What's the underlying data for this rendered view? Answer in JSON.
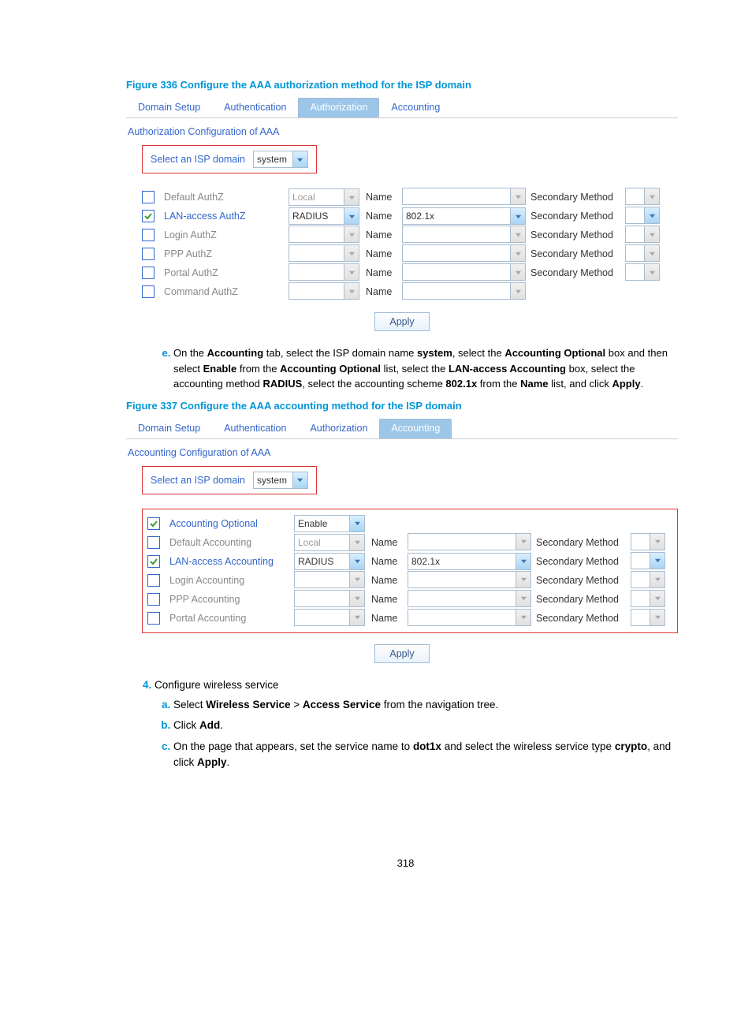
{
  "page_number": "318",
  "fig1": {
    "caption": "Figure 336 Configure the AAA authorization method for the ISP domain",
    "tabs": [
      "Domain Setup",
      "Authentication",
      "Authorization",
      "Accounting"
    ],
    "active_tab": 2,
    "section_title": "Authorization Configuration of AAA",
    "isp_label": "Select an ISP domain",
    "isp_value": "system",
    "name_lbl": "Name",
    "sec_lbl": "Secondary Method",
    "rows": [
      {
        "chk": false,
        "dis": true,
        "label": "Default AuthZ",
        "method": "Local",
        "method_dis": true,
        "scheme": "",
        "scheme_dis": true,
        "has_sec": true,
        "sec_dis": true
      },
      {
        "chk": true,
        "dis": false,
        "label": "LAN-access AuthZ",
        "method": "RADIUS",
        "method_dis": false,
        "scheme": "802.1x",
        "scheme_dis": false,
        "has_sec": true,
        "sec_dis": false
      },
      {
        "chk": false,
        "dis": true,
        "label": "Login AuthZ",
        "method": "",
        "method_dis": true,
        "scheme": "",
        "scheme_dis": true,
        "has_sec": true,
        "sec_dis": true
      },
      {
        "chk": false,
        "dis": true,
        "label": "PPP AuthZ",
        "method": "",
        "method_dis": true,
        "scheme": "",
        "scheme_dis": true,
        "has_sec": true,
        "sec_dis": true
      },
      {
        "chk": false,
        "dis": true,
        "label": "Portal AuthZ",
        "method": "",
        "method_dis": true,
        "scheme": "",
        "scheme_dis": true,
        "has_sec": true,
        "sec_dis": true
      },
      {
        "chk": false,
        "dis": true,
        "label": "Command AuthZ",
        "method": "",
        "method_dis": true,
        "scheme": "",
        "scheme_dis": true,
        "has_sec": false,
        "sec_dis": true
      }
    ],
    "apply": "Apply"
  },
  "step_e": {
    "marker": "e.",
    "parts": [
      "On the ",
      "Accounting",
      " tab, select the ISP domain name ",
      "system",
      ", select the ",
      "Accounting Optional",
      " box and then select ",
      "Enable",
      " from the ",
      "Accounting Optional",
      " list, select the ",
      "LAN-access Accounting",
      " box, select the accounting method ",
      "RADIUS",
      ", select the accounting scheme ",
      "802.1x",
      " from the ",
      "Name",
      " list, and click ",
      "Apply",
      "."
    ]
  },
  "fig2": {
    "caption": "Figure 337 Configure the AAA accounting method for the ISP domain",
    "tabs": [
      "Domain Setup",
      "Authentication",
      "Authorization",
      "Accounting"
    ],
    "active_tab": 3,
    "section_title": "Accounting Configuration of AAA",
    "isp_label": "Select an ISP domain",
    "isp_value": "system",
    "name_lbl": "Name",
    "sec_lbl": "Secondary Method",
    "opt_row": {
      "chk": true,
      "label": "Accounting Optional",
      "method": "Enable"
    },
    "rows": [
      {
        "chk": false,
        "dis": true,
        "label": "Default Accounting",
        "method": "Local",
        "method_dis": true,
        "scheme": "",
        "scheme_dis": true,
        "has_sec": true,
        "sec_dis": true
      },
      {
        "chk": true,
        "dis": false,
        "label": "LAN-access Accounting",
        "method": "RADIUS",
        "method_dis": false,
        "scheme": "802.1x",
        "scheme_dis": false,
        "has_sec": true,
        "sec_dis": false
      },
      {
        "chk": false,
        "dis": true,
        "label": "Login Accounting",
        "method": "",
        "method_dis": true,
        "scheme": "",
        "scheme_dis": true,
        "has_sec": true,
        "sec_dis": true
      },
      {
        "chk": false,
        "dis": true,
        "label": "PPP Accounting",
        "method": "",
        "method_dis": true,
        "scheme": "",
        "scheme_dis": true,
        "has_sec": true,
        "sec_dis": true
      },
      {
        "chk": false,
        "dis": true,
        "label": "Portal Accounting",
        "method": "",
        "method_dis": true,
        "scheme": "",
        "scheme_dis": true,
        "has_sec": true,
        "sec_dis": true
      }
    ],
    "apply": "Apply"
  },
  "step4": {
    "title": "Configure wireless service",
    "a_parts": [
      "Select ",
      "Wireless Service",
      " > ",
      "Access Service",
      " from the navigation tree."
    ],
    "b_parts": [
      "Click ",
      "Add",
      "."
    ],
    "c_parts": [
      "On the page that appears, set the service name to ",
      "dot1x",
      " and select the wireless service type ",
      "crypto",
      ", and click ",
      "Apply",
      "."
    ]
  }
}
